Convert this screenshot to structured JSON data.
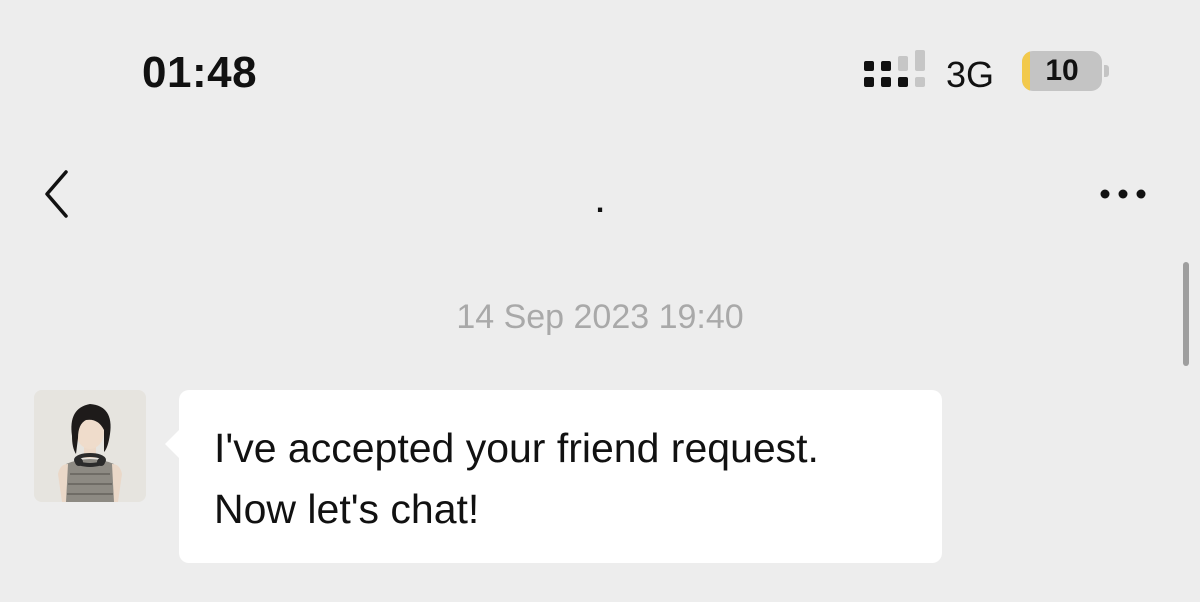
{
  "status_bar": {
    "time": "01:48",
    "network_type": "3G",
    "battery_level": "10",
    "battery_fraction": 0.1
  },
  "nav": {
    "title": "."
  },
  "chat": {
    "timestamp": "14 Sep 2023 19:40",
    "messages": [
      {
        "sender": "contact",
        "lines": [
          "I've accepted your friend request.",
          "Now let's chat!"
        ]
      }
    ]
  },
  "colors": {
    "background": "#ededed",
    "bubble": "#ffffff",
    "battery_accent": "#f2c94c",
    "timestamp_text": "#a9a9a9"
  },
  "icons": {
    "back": "chevron-left-icon",
    "more": "more-horizontal-icon",
    "signal": "signal-strength-icon",
    "battery": "battery-icon"
  }
}
